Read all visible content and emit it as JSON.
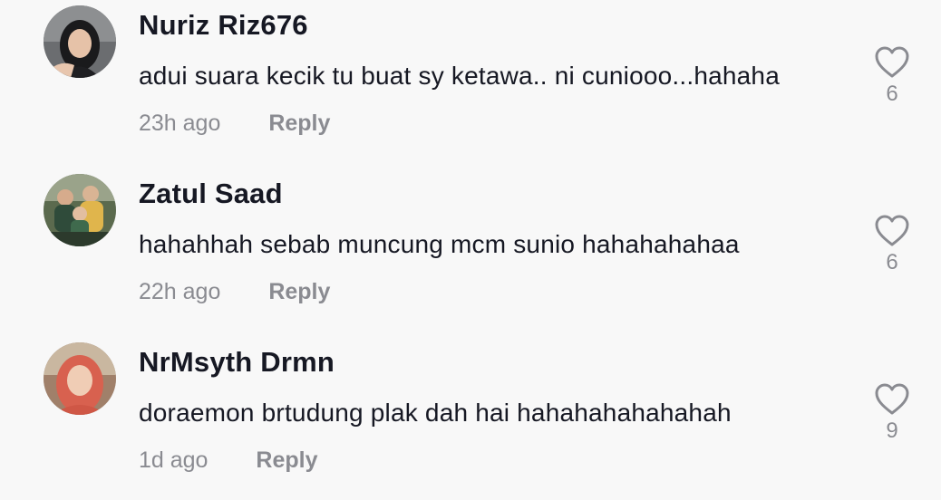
{
  "comments": [
    {
      "username": "Nuriz Riz676",
      "text": "adui suara kecik tu buat sy ketawa.. ni cuniooo...hahaha",
      "time": "23h ago",
      "reply_label": "Reply",
      "likes": "6",
      "avatar_icon": "profile-photo-woman-hijab-black"
    },
    {
      "username": "Zatul Saad",
      "text": "hahahhah sebab muncung mcm sunio hahahahahaa",
      "time": "22h ago",
      "reply_label": "Reply",
      "likes": "6",
      "avatar_icon": "profile-photo-family-group"
    },
    {
      "username": "NrMsyth Drmn",
      "text": "doraemon brtudung plak dah hai hahahahahahahah",
      "time": "1d ago",
      "reply_label": "Reply",
      "likes": "9",
      "avatar_icon": "profile-photo-woman-hijab-red"
    }
  ],
  "colors": {
    "background": "#f8f8f8",
    "username": "#161823",
    "text": "#161823",
    "meta": "#8a8b91",
    "heart": "#8a8b91"
  }
}
